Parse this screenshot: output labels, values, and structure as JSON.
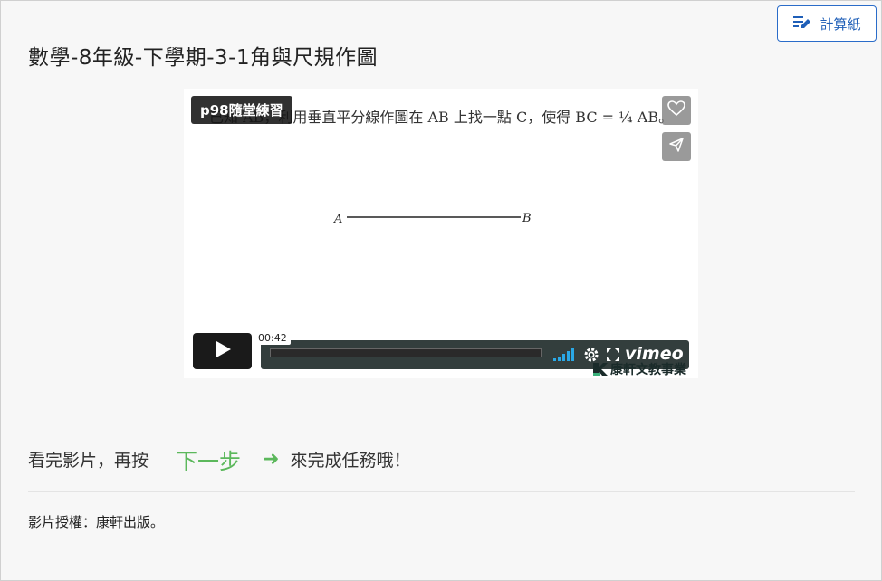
{
  "toolbar": {
    "scratch_label": "計算紙"
  },
  "page": {
    "title": "數學-8年級-下學期-3-1角與尺規作圖"
  },
  "video": {
    "title": "p98隨堂練習",
    "question_text": "已知 AB，利用垂直平分線作圖在 AB 上找一點 C，使得 BC = ¼ AB。",
    "point_a": "A",
    "point_b": "B",
    "time": "00:42",
    "logo": "vimeo",
    "watermark": "康軒文教事業",
    "played_fraction": 0.0
  },
  "instruction": {
    "before": "看完影片，再按",
    "next_label": "下一步",
    "arrow": "➜",
    "after": "來完成任務哦！"
  },
  "credit": {
    "text": "影片授權：康軒出版。"
  },
  "colors": {
    "accent": "#2a6cc9",
    "next": "#5cb85c",
    "video_bar": "#172322"
  },
  "icons": [
    "edit-note-icon",
    "heart-icon",
    "send-icon",
    "play-icon",
    "volume-icon",
    "settings-icon",
    "fullscreen-icon"
  ]
}
